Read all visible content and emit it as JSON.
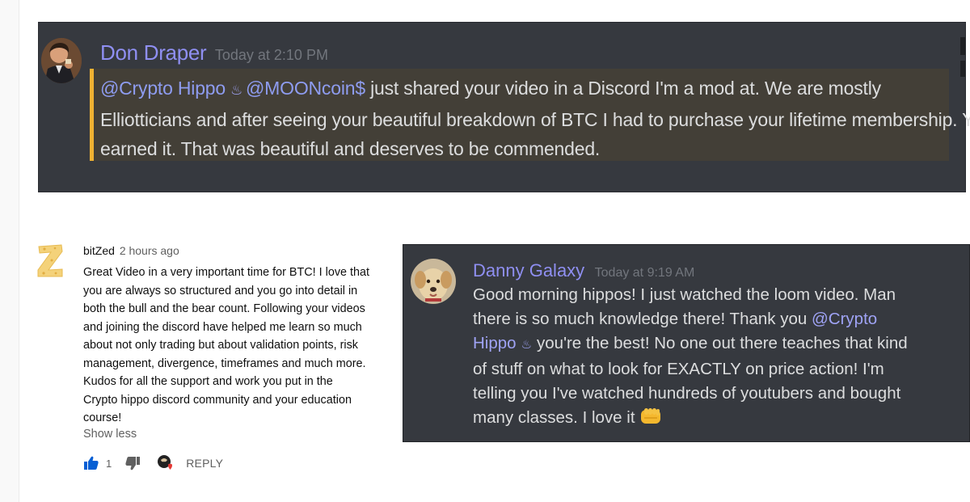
{
  "discord_message_1": {
    "author": "Don Draper",
    "timestamp": "Today at 2:10 PM",
    "mentions": [
      "@Crypto Hippo",
      "@MOONcoin$"
    ],
    "text_after_mentions": "just shared your video in a Discord I'm a mod at. We are mostly",
    "line_2": "Elliotticians and after seeing your beautiful breakdown of BTC I had to purchase your lifetime membership. You",
    "line_3": "earned it. That was beautiful and deserves to be commended.",
    "quote_accent_color": "#f0b232",
    "hippo_emoji": "♨"
  },
  "youtube_comment": {
    "author": "bitZed",
    "timestamp": "2 hours ago",
    "body_lines": [
      "Great Video in a very important time for BTC! I love that",
      "you are always so structured and you go into detail in",
      "both the bull and the bear count. Following your videos",
      "and joining the discord have helped me learn so much",
      "about not only trading but about validation points, risk",
      "management, divergence, timeframes and much more.",
      "Kudos for all the support and work you put in the",
      "Crypto hippo discord community and your education",
      "course!"
    ],
    "show_less_label": "Show less",
    "like_count": "1",
    "reply_label": "REPLY",
    "icons": {
      "like": "thumb-up-icon",
      "dislike": "thumb-down-icon",
      "creator_heart": "creator-heart-icon"
    }
  },
  "discord_message_2": {
    "author": "Danny Galaxy",
    "timestamp": "Today at 9:19 AM",
    "line_1": "Good morning hippos! I just watched the loom video. Man",
    "line_2_pre": "there is so much knowledge there! Thank you",
    "mention_part_1": "@Crypto",
    "mention_part_2": "Hippo",
    "hippo_emoji": "♨",
    "line_3_post": "you're the best! No one out there teaches that kind",
    "line_4": "of stuff on what to look for EXACTLY on price action! I'm",
    "line_5": "telling you I've watched hundreds of youtubers and bought",
    "line_6": "many classes. I love it",
    "fist_emoji": "fist-bump-icon"
  }
}
